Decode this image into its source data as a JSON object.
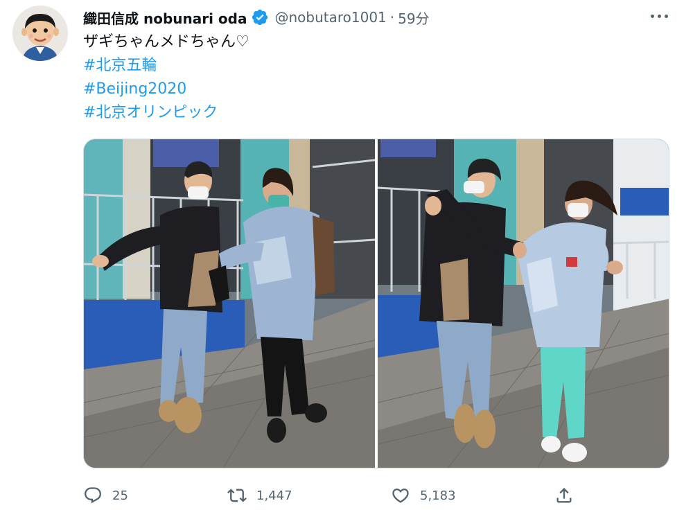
{
  "tweet": {
    "author": {
      "display_name": "織田信成 nobunari oda",
      "handle": "@nobutaro1001",
      "separator": "·",
      "time": "59分",
      "verified": true,
      "avatar_icon": "cartoon-avatar-icon"
    },
    "text_line": "ザギちゃんメドちゃん♡",
    "hashtags": [
      "#北京五輪",
      "#Beijing2020",
      "#北京オリンピック"
    ],
    "actions": {
      "reply_count": "25",
      "retweet_count": "1,447",
      "like_count": "5,183"
    },
    "media_count": 2
  },
  "colors": {
    "link": "#1d9bf0",
    "secondary_text": "#536471",
    "verified_badge": "#1d9bf0",
    "primary_text": "#0f1419"
  },
  "icons": {
    "more": "more-horizontal-icon",
    "verified": "verified-badge-icon",
    "reply": "reply-icon",
    "retweet": "retweet-icon",
    "like": "heart-icon",
    "share": "share-icon"
  }
}
